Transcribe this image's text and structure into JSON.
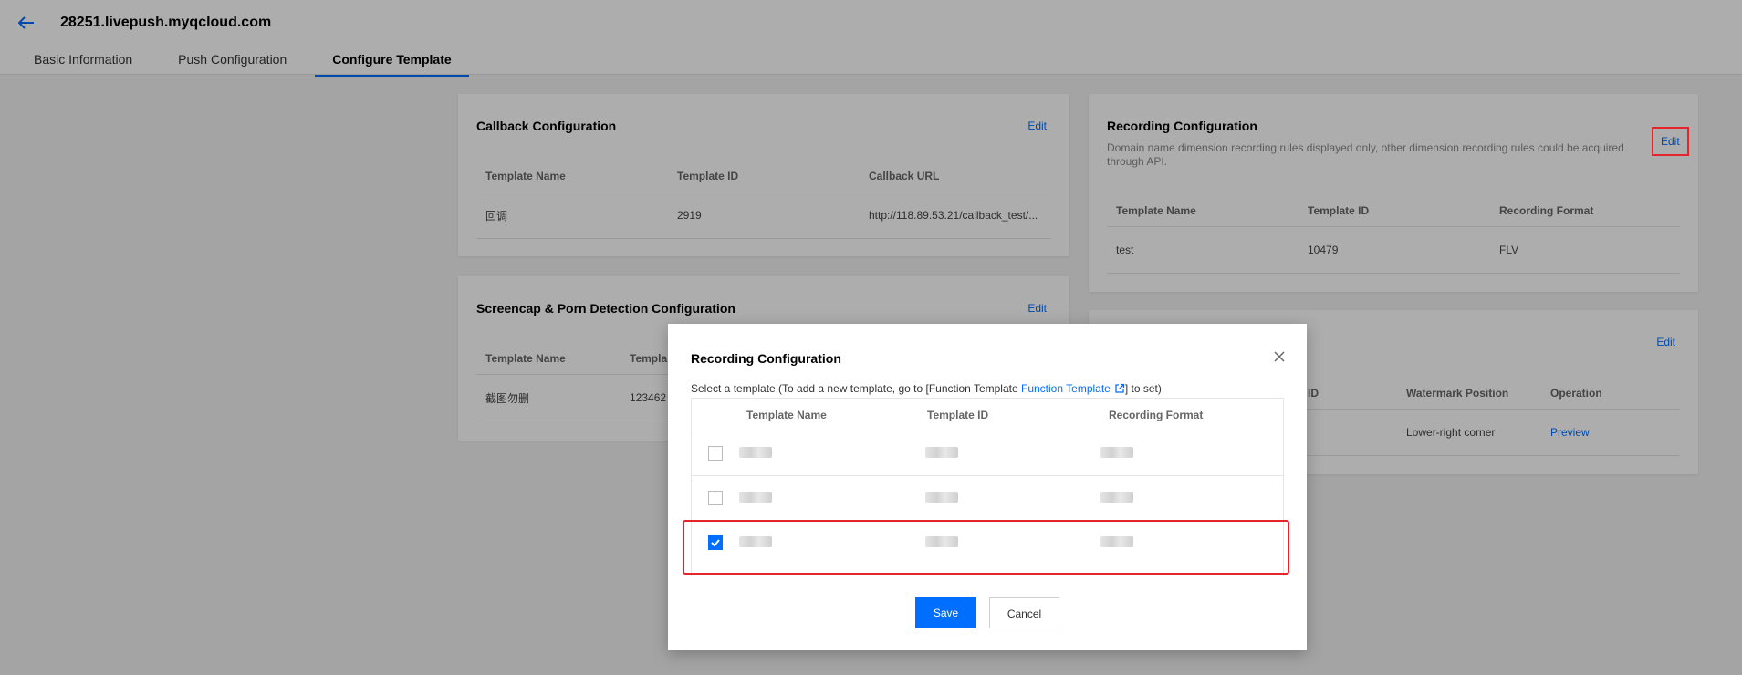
{
  "header": {
    "title": "28251.livepush.myqcloud.com",
    "tabs": [
      {
        "label": "Basic Information"
      },
      {
        "label": "Push Configuration"
      },
      {
        "label": "Configure Template"
      }
    ]
  },
  "callback": {
    "title": "Callback Configuration",
    "edit": "Edit",
    "columns": [
      "Template Name",
      "Template ID",
      "Callback URL"
    ],
    "rows": [
      [
        "回调",
        "2919",
        "http://118.89.53.21/callback_test/..."
      ]
    ]
  },
  "screencap": {
    "title": "Screencap & Porn Detection Configuration",
    "edit": "Edit",
    "columns": [
      "Template Name",
      "Templa"
    ],
    "rows": [
      [
        "截图勿删",
        "123462"
      ]
    ]
  },
  "recording": {
    "title": "Recording Configuration",
    "desc": "Domain name dimension recording rules displayed only, other dimension recording rules could be acquired through API.",
    "edit": "Edit",
    "columns": [
      "Template Name",
      "Template ID",
      "Recording Format"
    ],
    "rows": [
      [
        "test",
        "10479",
        "FLV"
      ]
    ]
  },
  "watermark": {
    "edit": "Edit",
    "columns": [
      "ID",
      "Watermark Position",
      "Operation"
    ],
    "rows": [
      [
        "",
        "Lower-right corner",
        "Preview"
      ]
    ]
  },
  "modal": {
    "title": "Recording Configuration",
    "desc_prefix": "Select a template (To add a new template, go to [Function Template ",
    "desc_link": "Function Template",
    "desc_suffix": "] to set)",
    "columns": [
      "Template Name",
      "Template ID",
      "Recording Format"
    ],
    "rows": [
      {
        "checked": false
      },
      {
        "checked": false
      },
      {
        "checked": true
      }
    ],
    "save": "Save",
    "cancel": "Cancel"
  },
  "colors": {
    "accent": "#006eff",
    "highlight": "#e5242b"
  }
}
